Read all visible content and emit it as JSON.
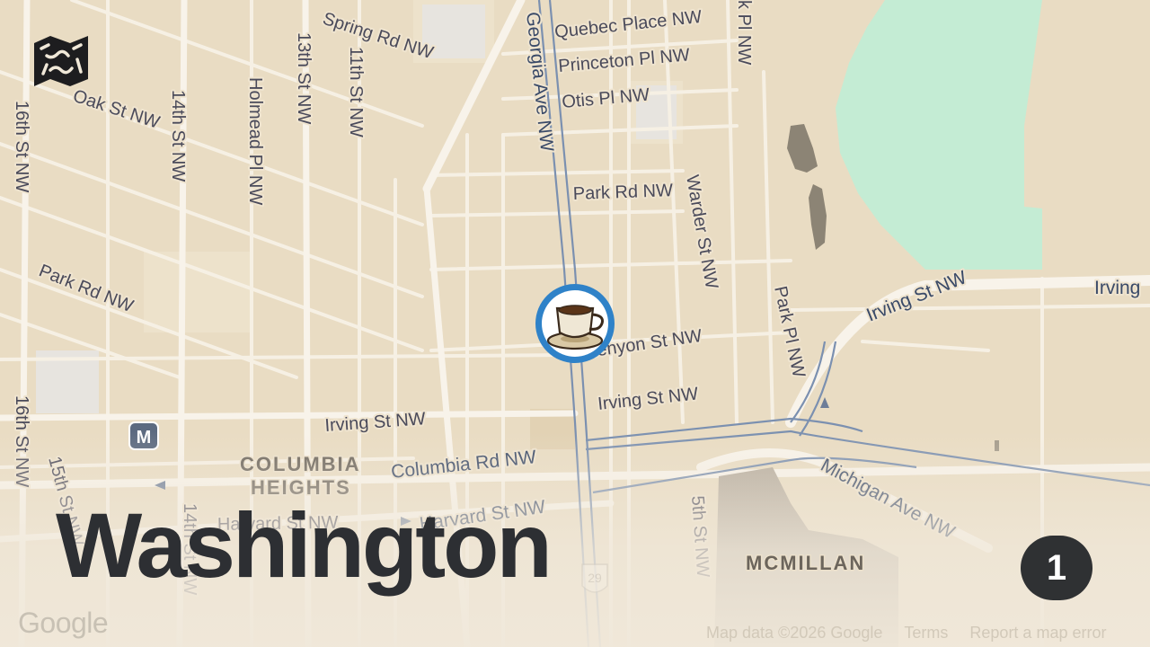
{
  "map": {
    "city_title": "Washington",
    "badge_count": "1",
    "metro_label": "M",
    "route_shield": "29",
    "poi": {
      "icon": "coffee-cup-icon",
      "type": "cafe"
    },
    "streets": {
      "sixteenth_top": "16th St NW",
      "sixteenth_bottom": "16th St NW",
      "fourteenth_top": "14th St NW",
      "fourteenth_bottom": "14th St NW",
      "thirteenth": "13th St NW",
      "eleventh": "11th St NW",
      "fifteenth": "15th St NW",
      "holmead": "Holmead Pl NW",
      "oak": "Oak St NW",
      "spring": "Spring Rd NW",
      "georgia": "Georgia Ave NW",
      "quebec": "Quebec Place NW",
      "princeton": "Princeton Pl NW",
      "otis": "Otis Pl NW",
      "park_rd_center": "Park Rd NW",
      "park_rd_left": "Park Rd NW",
      "warder": "Warder St NW",
      "park_pl_top": "k Pl NW",
      "park_pl": "Park Pl NW",
      "kenyon": "Kenyon St NW",
      "irving_center": "Irving St NW",
      "irving_left": "Irving St NW",
      "irving_right": "Irving St NW",
      "irving_edge": "Irving",
      "columbia": "Columbia Rd NW",
      "harvard_left": "Harvard St NW",
      "harvard_right": "Harvard St NW",
      "michigan": "Michigan Ave NW",
      "fifth": "5th St NW"
    },
    "areas": {
      "columbia_1": "COLUMBIA",
      "columbia_2": "HEIGHTS",
      "mcmillan": "MCMILLAN"
    },
    "attribution": {
      "google": "Google",
      "map_data": "Map data ©2026 Google",
      "terms": "Terms",
      "report": "Report a map error"
    },
    "colors": {
      "land": "#e9dcc3",
      "block": "#e4d5b9",
      "minor_road": "#f6f0e4",
      "major_road": "#f8f3ea",
      "park": "#c4ecd4",
      "transit_line": "#7b90b0",
      "poi_ring": "#2f82c8",
      "badge": "#2f3133"
    }
  }
}
